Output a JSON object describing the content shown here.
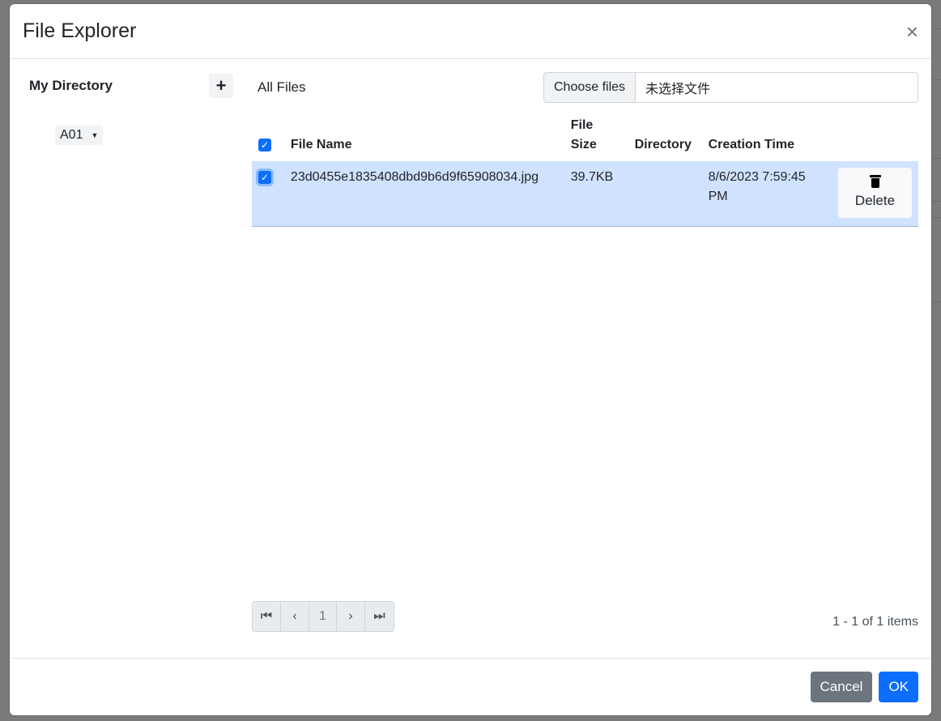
{
  "modal": {
    "title": "File Explorer",
    "close_glyph": "×"
  },
  "sidebar": {
    "title": "My Directory",
    "add_glyph": "+",
    "items": [
      {
        "label": "A01",
        "caret": "▼"
      }
    ]
  },
  "main": {
    "heading": "All Files",
    "file_input": {
      "button_label": "Choose files",
      "status": "未选择文件"
    },
    "table": {
      "headers": {
        "file_name": "File Name",
        "file_size_1": "File",
        "file_size_2": "Size",
        "directory": "Directory",
        "creation_time": "Creation Time"
      },
      "rows": [
        {
          "file_name": "23d0455e1835408dbd9b6d9f65908034.jpg",
          "file_size": "39.7KB",
          "directory": "",
          "creation_time": "8/6/2023 7:59:45 PM",
          "delete_label": "Delete",
          "checked": true
        }
      ]
    },
    "pager": {
      "first": "⏮",
      "prev": "‹",
      "page": "1",
      "next": "›",
      "last": "⏭"
    },
    "items_count": "1 - 1 of 1 items"
  },
  "footer": {
    "cancel_label": "Cancel",
    "ok_label": "OK"
  },
  "colors": {
    "primary": "#0d6efd",
    "selected_row": "#cfe2ff",
    "secondary": "#6c757d"
  }
}
